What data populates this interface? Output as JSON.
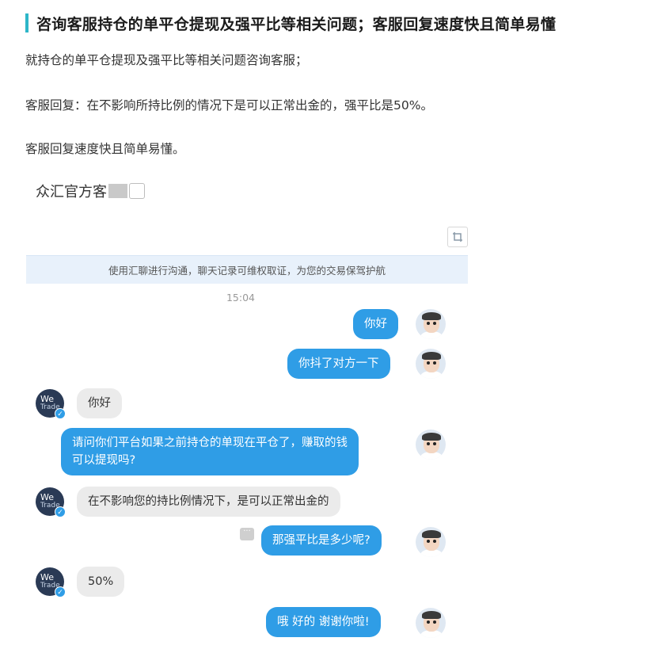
{
  "article": {
    "heading": "咨询客服持仓的单平仓提现及强平比等相关问题；客服回复速度快且简单易懂",
    "para1": "就持仓的单平仓提现及强平比等相关问题咨询客服；",
    "para2": "客服回复：在不影响所持比例的情况下是可以正常出金的，强平比是50%。",
    "para3": "客服回复速度快且简单易懂。"
  },
  "chat": {
    "contact_name": "众汇官方客",
    "notice": "使用汇聊进行沟通，聊天记录可维权取证，为您的交易保驾护航",
    "timestamp": "15:04",
    "agent_avatar": {
      "line1": "We",
      "line2": "Trade"
    },
    "messages": [
      {
        "from": "me",
        "text": "你好"
      },
      {
        "from": "me",
        "text": "你抖了对方一下"
      },
      {
        "from": "agent",
        "text": "你好"
      },
      {
        "from": "me",
        "line1": "请问你们平台如果之前持仓的单现在平仓了，赚取的钱",
        "line2": "可以提现吗?"
      },
      {
        "from": "agent",
        "text": "在不影响您的持比例情况下，是可以正常出金的"
      },
      {
        "from": "me",
        "text": "那强平比是多少呢?"
      },
      {
        "from": "agent",
        "text": "50%"
      },
      {
        "from": "me",
        "text": "哦 好的 谢谢你啦!"
      }
    ]
  },
  "colors": {
    "accent_bar": "#2db6c8",
    "outgoing_bubble": "#2f9de6",
    "incoming_bubble": "#ebebeb",
    "notice_bg": "#e8f1fb"
  },
  "icons": {
    "screenshot_tool": "crop-icon",
    "more": "more-dots-icon",
    "verified": "check-icon"
  }
}
